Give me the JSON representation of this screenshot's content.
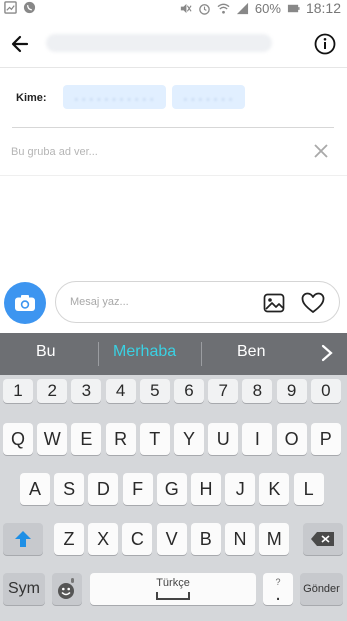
{
  "status_bar": {
    "battery": "60%",
    "time": "18:12"
  },
  "header": {
    "back_icon": "arrow-left-icon",
    "info_icon": "info-circle-icon"
  },
  "recipients": {
    "label": "Kime:"
  },
  "group": {
    "name_placeholder": "Bu gruba ad ver..."
  },
  "composer": {
    "message_placeholder": "Mesaj yaz...",
    "camera_icon": "camera-icon",
    "gallery_icon": "image-icon",
    "like_icon": "heart-icon",
    "accent_color": "#3d95f0"
  },
  "keyboard": {
    "suggestions": [
      "Bu",
      "Merhaba",
      "Ben"
    ],
    "active_suggestion": "Merhaba",
    "number_row": [
      "1",
      "2",
      "3",
      "4",
      "5",
      "6",
      "7",
      "8",
      "9",
      "0"
    ],
    "row1": [
      "Q",
      "W",
      "E",
      "R",
      "T",
      "Y",
      "U",
      "I",
      "O",
      "P"
    ],
    "row2": [
      "A",
      "S",
      "D",
      "F",
      "G",
      "H",
      "J",
      "K",
      "L"
    ],
    "row3": [
      "Z",
      "X",
      "C",
      "V",
      "B",
      "N",
      "M"
    ],
    "sym_label": "Sym",
    "space_label": "Türkçe",
    "punct_top": "?",
    "punct_main": ".",
    "send_label": "Gönder"
  }
}
